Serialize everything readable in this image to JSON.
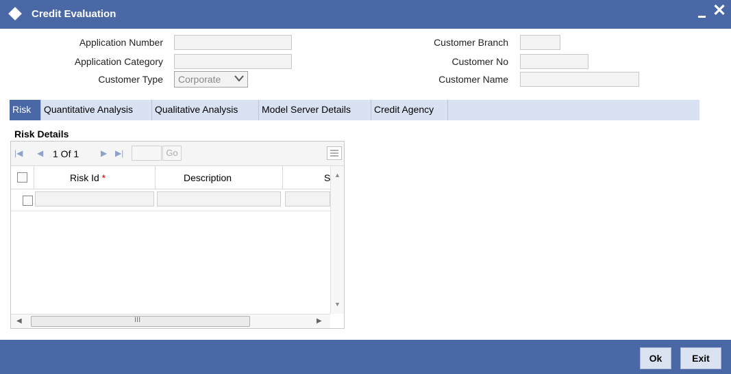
{
  "window": {
    "title": "Credit Evaluation",
    "minimize_label": "",
    "close_label": "✕"
  },
  "form": {
    "application_number": {
      "label": "Application Number",
      "value": ""
    },
    "application_category": {
      "label": "Application Category",
      "value": ""
    },
    "customer_type": {
      "label": "Customer Type",
      "value": "Corporate"
    },
    "customer_branch": {
      "label": "Customer Branch",
      "value": ""
    },
    "customer_no": {
      "label": "Customer No",
      "value": ""
    },
    "customer_name": {
      "label": "Customer Name",
      "value": ""
    }
  },
  "tabs": [
    {
      "label": "Risk",
      "active": true
    },
    {
      "label": "Quantitative Analysis",
      "active": false
    },
    {
      "label": "Qualitative Analysis",
      "active": false
    },
    {
      "label": "Model Server Details",
      "active": false
    },
    {
      "label": "Credit Agency",
      "active": false
    }
  ],
  "risk_details": {
    "title": "Risk Details",
    "pager": {
      "text": "1 Of 1",
      "go_label": "Go",
      "page_value": ""
    },
    "columns": [
      {
        "label": "Risk Id",
        "required_marker": "*"
      },
      {
        "label": "Description"
      },
      {
        "label": "S"
      }
    ],
    "rows": [
      {
        "risk_id": "",
        "description": "",
        "s": ""
      }
    ],
    "hscroll_grip": "III"
  },
  "footer": {
    "ok_label": "Ok",
    "exit_label": "Exit"
  },
  "colors": {
    "titlebar": "#4a67a6",
    "tab_active": "#4a67a6",
    "tabbar": "#d9e2f3",
    "required": "#dd0000"
  }
}
